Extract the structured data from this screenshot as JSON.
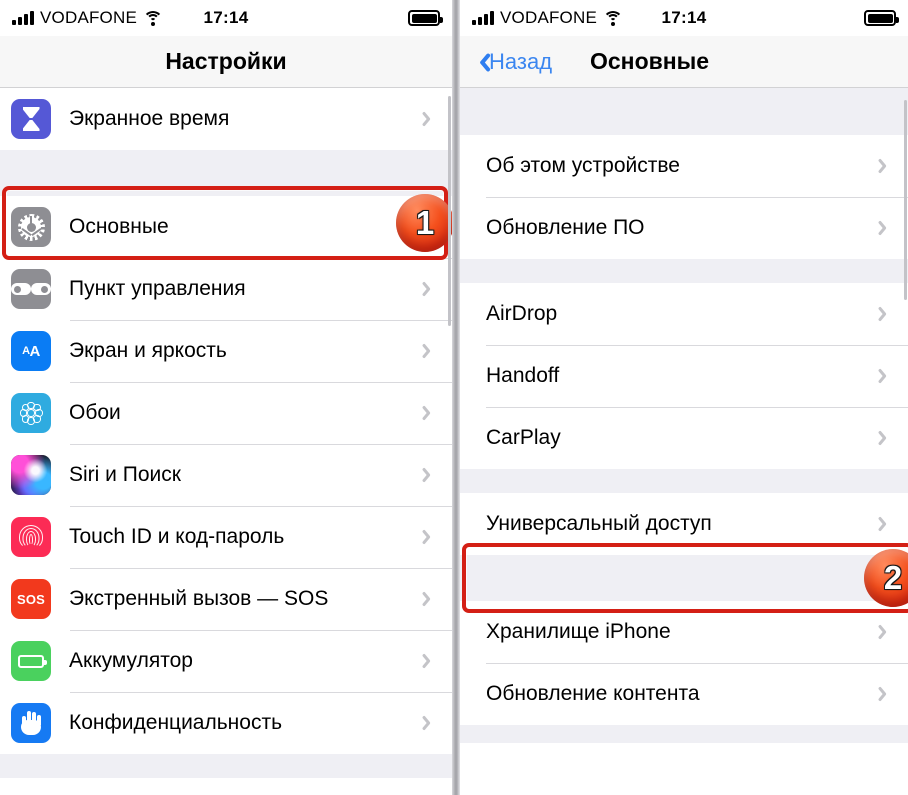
{
  "status_bar": {
    "carrier": "VODAFONE",
    "time": "17:14",
    "signal_icon": "cellular-bars-icon",
    "wifi_icon": "wifi-icon",
    "battery_icon": "battery-full-icon"
  },
  "left_panel": {
    "title": "Настройки",
    "groups": [
      {
        "rows": [
          {
            "label": "Экранное время",
            "icon": "hourglass-icon",
            "chevron": "chevron-right-icon"
          }
        ]
      },
      {
        "rows": [
          {
            "label": "Основные",
            "icon": "gear-icon",
            "chevron": "chevron-right-icon",
            "highlighted": true
          },
          {
            "label": "Пункт управления",
            "icon": "sliders-icon",
            "chevron": "chevron-right-icon"
          },
          {
            "label": "Экран и яркость",
            "icon": "text-size-icon",
            "chevron": "chevron-right-icon"
          },
          {
            "label": "Обои",
            "icon": "flower-icon",
            "chevron": "chevron-right-icon"
          },
          {
            "label": "Siri и Поиск",
            "icon": "siri-orb-icon",
            "chevron": "chevron-right-icon"
          },
          {
            "label": "Touch ID и код-пароль",
            "icon": "fingerprint-icon",
            "chevron": "chevron-right-icon"
          },
          {
            "label": "Экстренный вызов — SOS",
            "icon": "sos-icon",
            "chevron": "chevron-right-icon"
          },
          {
            "label": "Аккумулятор",
            "icon": "battery-icon",
            "chevron": "chevron-right-icon"
          },
          {
            "label": "Конфиденциальность",
            "icon": "hand-icon",
            "chevron": "chevron-right-icon"
          }
        ]
      }
    ]
  },
  "right_panel": {
    "back_label": "Назад",
    "back_icon": "chevron-left-icon",
    "title": "Основные",
    "groups": [
      {
        "rows": [
          {
            "label": "Об этом устройстве",
            "chevron": "chevron-right-icon"
          },
          {
            "label": "Обновление ПО",
            "chevron": "chevron-right-icon"
          }
        ]
      },
      {
        "rows": [
          {
            "label": "AirDrop",
            "chevron": "chevron-right-icon"
          },
          {
            "label": "Handoff",
            "chevron": "chevron-right-icon"
          },
          {
            "label": "CarPlay",
            "chevron": "chevron-right-icon"
          }
        ]
      },
      {
        "rows": [
          {
            "label": "Универсальный доступ",
            "chevron": "chevron-right-icon",
            "highlighted": true
          }
        ]
      },
      {
        "rows": [
          {
            "label": "Хранилище iPhone",
            "chevron": "chevron-right-icon"
          },
          {
            "label": "Обновление контента",
            "chevron": "chevron-right-icon"
          }
        ]
      }
    ]
  },
  "annotations": {
    "step_one": "1",
    "step_two": "2",
    "highlight_color": "#d41f15",
    "badge_color": "#f4501d"
  }
}
